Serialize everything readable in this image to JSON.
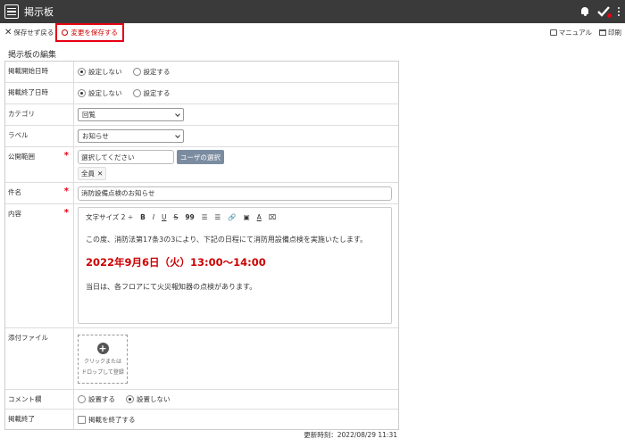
{
  "app": {
    "title": "掲示板"
  },
  "toolbar": {
    "discard_label": "保存せず戻る",
    "save_label": "変更を保存する",
    "manual_label": "マニュアル",
    "print_label": "印刷"
  },
  "section_title": "掲示板の編集",
  "fields": {
    "start": {
      "label": "掲載開始日時",
      "options": [
        "設定しない",
        "設定する"
      ],
      "selected": "設定しない"
    },
    "end": {
      "label": "掲載終了日時",
      "options": [
        "設定しない",
        "設定する"
      ],
      "selected": "設定しない"
    },
    "category": {
      "label": "カテゴリ",
      "value": "回覧"
    },
    "label": {
      "label": "ラベル",
      "value": "お知らせ"
    },
    "scope": {
      "label": "公開範囲",
      "placeholder": "選択してください",
      "button": "ユーザの選択",
      "tags": [
        "全員"
      ]
    },
    "subject": {
      "label": "件名",
      "value": "消防設備点検のお知らせ"
    },
    "content": {
      "label": "内容",
      "toolbar": {
        "font_size": "文字サイズ 2 ÷",
        "bold": "B",
        "italic": "I",
        "underline": "U",
        "strike": "S",
        "quote": "99"
      },
      "para1": "この度、消防法第17条3の3により、下記の日程にて消防用設備点検を実施いたします。",
      "highlight": "2022年9月6日（火）13:00〜14:00",
      "para2": "当日は、各フロアにて火災報知器の点検があります。"
    },
    "attachment": {
      "label": "添付ファイル",
      "drop_line1": "クリックまたは",
      "drop_line2": "ドロップして登録"
    },
    "comment": {
      "label": "コメント欄",
      "options": [
        "設置する",
        "設置しない"
      ],
      "selected": "設置しない"
    },
    "close": {
      "label": "掲載終了",
      "checkbox_label": "掲載を終了する"
    }
  },
  "updated": "更新時刻：2022/08/29 11:31"
}
